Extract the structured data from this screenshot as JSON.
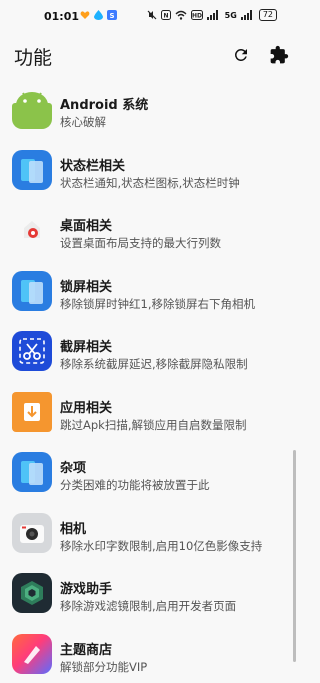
{
  "status_bar": {
    "time": "01:01",
    "battery": "72",
    "network": "5G"
  },
  "app_bar": {
    "title": "功能"
  },
  "items": [
    {
      "title": "Android 系统",
      "subtitle": "核心破解",
      "icon": "android-icon"
    },
    {
      "title": "状态栏相关",
      "subtitle": "状态栏通知,状态栏图标,状态栏时钟",
      "icon": "app-blue-icon"
    },
    {
      "title": "桌面相关",
      "subtitle": "设置桌面布局支持的最大行列数",
      "icon": "launcher-icon"
    },
    {
      "title": "锁屏相关",
      "subtitle": "移除锁屏时钟红1,移除锁屏右下角相机",
      "icon": "app-blue-icon"
    },
    {
      "title": "截屏相关",
      "subtitle": "移除系统截屏延迟,移除截屏隐私限制",
      "icon": "scissors-icon"
    },
    {
      "title": "应用相关",
      "subtitle": "跳过Apk扫描,解锁应用自启数量限制",
      "icon": "download-box-icon"
    },
    {
      "title": "杂项",
      "subtitle": "分类困难的功能将被放置于此",
      "icon": "app-blue-icon"
    },
    {
      "title": "相机",
      "subtitle": "移除水印字数限制,启用10亿色影像支持",
      "icon": "camera-icon"
    },
    {
      "title": "游戏助手",
      "subtitle": "移除游戏滤镜限制,启用开发者页面",
      "icon": "game-assistant-icon"
    },
    {
      "title": "主题商店",
      "subtitle": "解锁部分功能VIP",
      "icon": "theme-store-icon"
    }
  ]
}
